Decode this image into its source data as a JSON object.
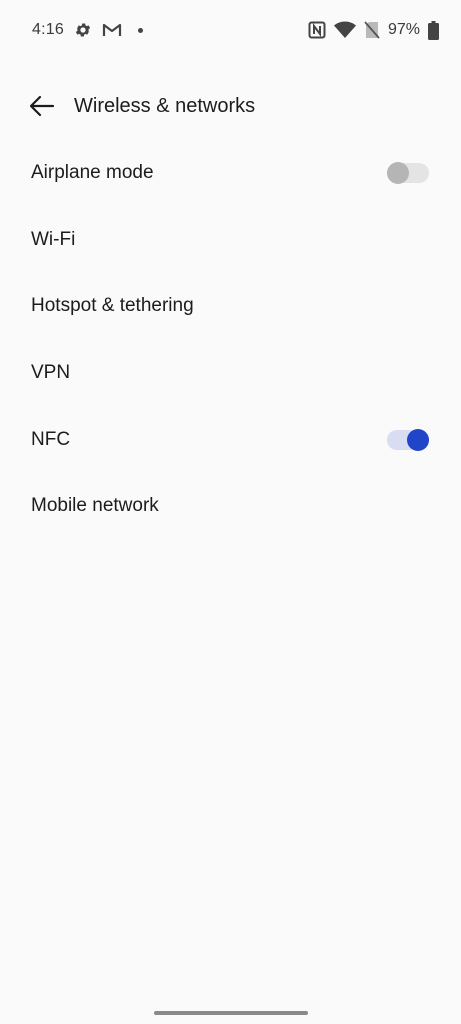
{
  "status_bar": {
    "time": "4:16",
    "battery": "97%",
    "icons": [
      "settings-icon",
      "gmail-icon",
      "notification-dot",
      "nfc-icon",
      "wifi-icon",
      "no-sim-icon",
      "battery-icon"
    ]
  },
  "header": {
    "title": "Wireless & networks",
    "back_icon": "arrow-left-icon"
  },
  "settings": {
    "items": [
      {
        "label": "Airplane mode",
        "toggle": "off"
      },
      {
        "label": "Wi-Fi"
      },
      {
        "label": "Hotspot & tethering"
      },
      {
        "label": "VPN"
      },
      {
        "label": "NFC",
        "toggle": "on"
      },
      {
        "label": "Mobile network"
      }
    ]
  },
  "colors": {
    "background": "#fafafa",
    "accent": "#2145c8",
    "toggle_on_track": "#d9ddf2",
    "toggle_off_track": "#e4e4e4",
    "toggle_off_thumb": "#b5b5b5"
  }
}
